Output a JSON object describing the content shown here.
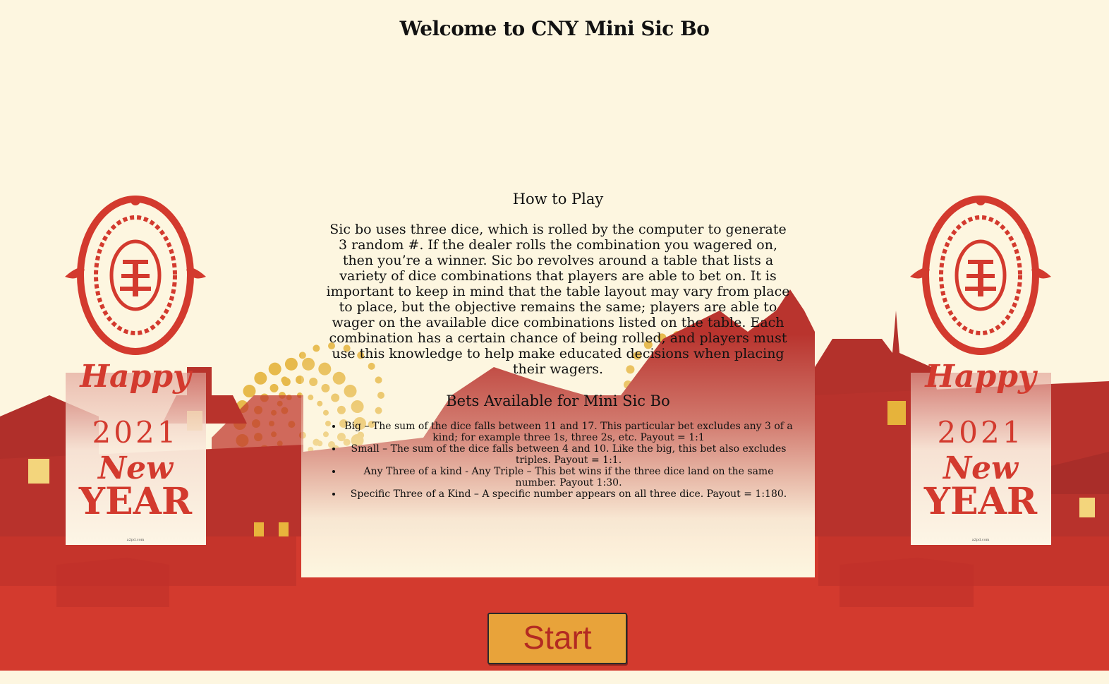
{
  "page": {
    "title": "Welcome to CNY Mini Sic Bo"
  },
  "colors": {
    "background": "#fdf6e0",
    "red": "#d33a2e",
    "dark_red": "#a82b28",
    "gold": "#e8a33a"
  },
  "banners": {
    "line1": "Happy",
    "line2": "2021",
    "line3": "New",
    "line4": "YEAR",
    "credit": "a2pd.com",
    "emblem_icon": "fortune-fish-papercut-icon"
  },
  "how_to_play": {
    "title": "How to Play",
    "text": "Sic bo uses three dice, which is rolled by the computer to generate 3 random #. If the dealer rolls the combination you wagered on, then you’re a winner. Sic bo revolves around a table that lists a variety of dice combinations that players are able to bet on. It is important to keep in mind that the table layout may vary from place to place, but the objective remains the same; players are able to wager on the available dice combinations listed on the table. Each combination has a certain chance of being rolled, and players must use this knowledge to help make educated decisions when placing their wagers."
  },
  "bets": {
    "title": "Bets Available for Mini Sic Bo",
    "items": [
      "Big – The sum of the dice falls between 11 and 17. This particular bet excludes any 3 of a kind; for example three 1s, three 2s, etc. Payout = 1:1",
      "Small – The sum of the dice falls between 4 and 10. Like the big, this bet also excludes triples. Payout = 1:1.",
      "Any Three of a kind - Any Triple – This bet wins if the three dice land on the same number. Payout 1:30.",
      "Specific Three of a Kind – A specific number appears on all three dice. Payout = 1:180."
    ]
  },
  "start_button": {
    "label": "Start"
  }
}
